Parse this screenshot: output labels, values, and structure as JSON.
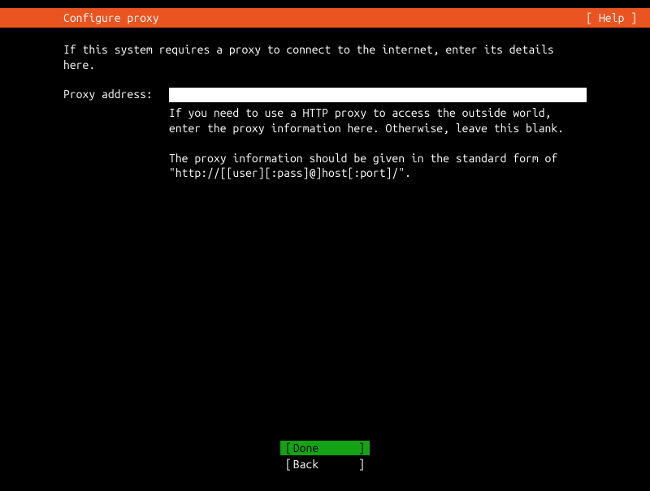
{
  "header": {
    "title": "Configure proxy",
    "help": "[ Help ]"
  },
  "main": {
    "intro": "If this system requires a proxy to connect to the internet, enter its details here.",
    "label": "Proxy address:",
    "input_value": "",
    "help1": "If you need to use a HTTP proxy to access the outside world, enter the proxy information here. Otherwise, leave this blank.",
    "help2": "The proxy information should be given in the standard form of \"http://[[user][:pass]@]host[:port]/\"."
  },
  "footer": {
    "done_open": "[",
    "done_label": "Done",
    "done_close": "]",
    "back_open": "[",
    "back_label": "Back",
    "back_close": "]"
  }
}
